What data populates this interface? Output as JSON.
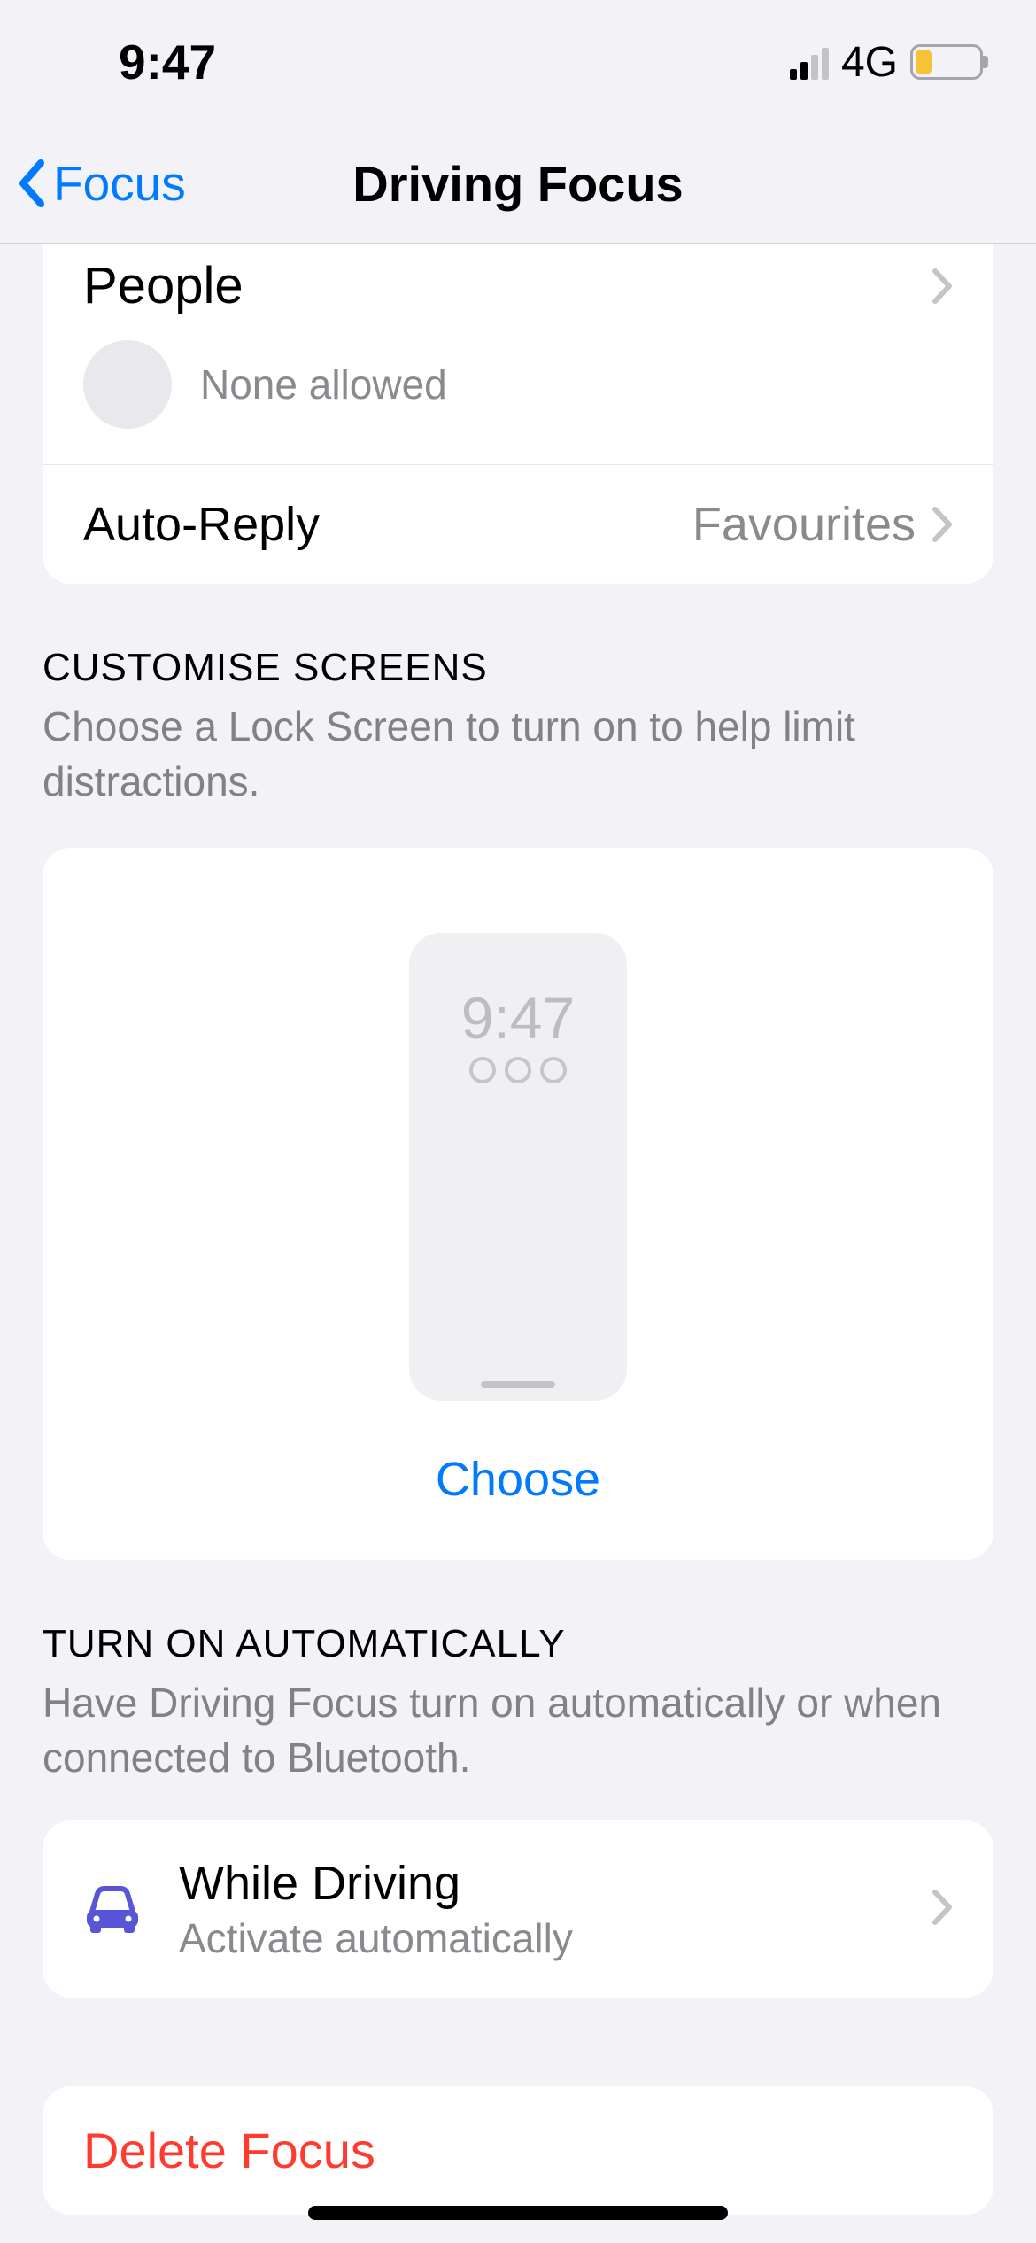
{
  "status": {
    "time": "9:47",
    "network": "4G"
  },
  "nav": {
    "back": "Focus",
    "title": "Driving Focus"
  },
  "allowed": {
    "people_label": "People",
    "people_sub": "None allowed",
    "auto_reply_label": "Auto-Reply",
    "auto_reply_value": "Favourites"
  },
  "customise": {
    "header": "CUSTOMISE SCREENS",
    "sub": "Choose a Lock Screen to turn on to help limit distractions.",
    "preview_time": "9:47",
    "choose": "Choose"
  },
  "automatic": {
    "header": "TURN ON AUTOMATICALLY",
    "sub": "Have Driving Focus turn on automatically or when connected to Bluetooth.",
    "row_title": "While Driving",
    "row_sub": "Activate automatically"
  },
  "delete": {
    "label": "Delete Focus"
  }
}
